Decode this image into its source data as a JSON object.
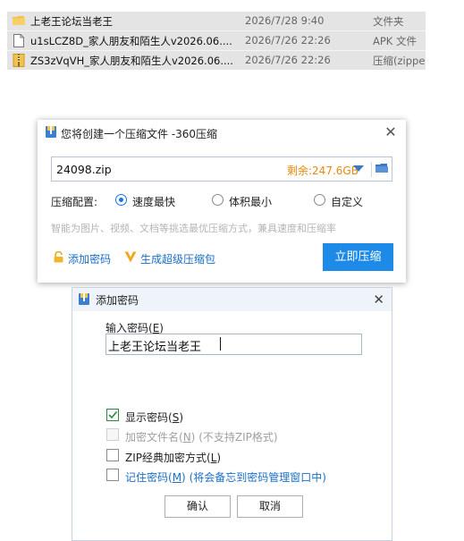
{
  "file_list": [
    {
      "name": "上老王论坛当老王",
      "date": "2026/7/28 9:40",
      "type": "文件夹",
      "icon": "folder-icon"
    },
    {
      "name": "u1sLCZ8D_家人朋友和陌生人v2026.06....",
      "date": "2026/7/26 22:26",
      "type": "APK 文件",
      "icon": "document-icon"
    },
    {
      "name": "ZS3zVqVH_家人朋友和陌生人v2026.06....",
      "date": "2026/7/26 22:26",
      "type": "压缩(zippe",
      "icon": "zip-icon"
    }
  ],
  "compress_dialog": {
    "title": "您将创建一个压缩文件 -360压缩",
    "close_label": "✕",
    "filename": "24098.zip",
    "free_space": "剩余:247.6GB",
    "config_label": "压缩配置:",
    "options": [
      "速度最快",
      "体积最小",
      "自定义"
    ],
    "selected_option": "速度最快",
    "hint": "智能为图片、视频、文档等挑选最优压缩方式，兼具速度和压缩率",
    "add_password_label": "添加密码",
    "super_pack_label": "生成超级压缩包",
    "compress_button": "立即压缩",
    "accent_color": "#1c8ae6"
  },
  "password_dialog": {
    "title": "添加密码",
    "close_label": "✕",
    "input_label": "输入密码(",
    "input_label_key": "E",
    "input_label_end": ")",
    "password_value": "上老王论坛当老王",
    "show_password": {
      "label": "显示密码(",
      "key": "S",
      "end": ")",
      "checked": true
    },
    "encrypt_filenames": {
      "label": "加密文件名(",
      "key": "N",
      "end": ")",
      "note": "(不支持ZIP格式)",
      "checked": false,
      "disabled": true
    },
    "zip_classic": {
      "label": "ZIP经典加密方式(",
      "key": "L",
      "end": ")",
      "checked": false
    },
    "remember_password": {
      "label": "记住密码(",
      "key": "M",
      "end": ")",
      "note": "(将会备忘到密码管理窗口中)",
      "checked": false
    },
    "ok_button": "确认",
    "cancel_button": "取消"
  }
}
